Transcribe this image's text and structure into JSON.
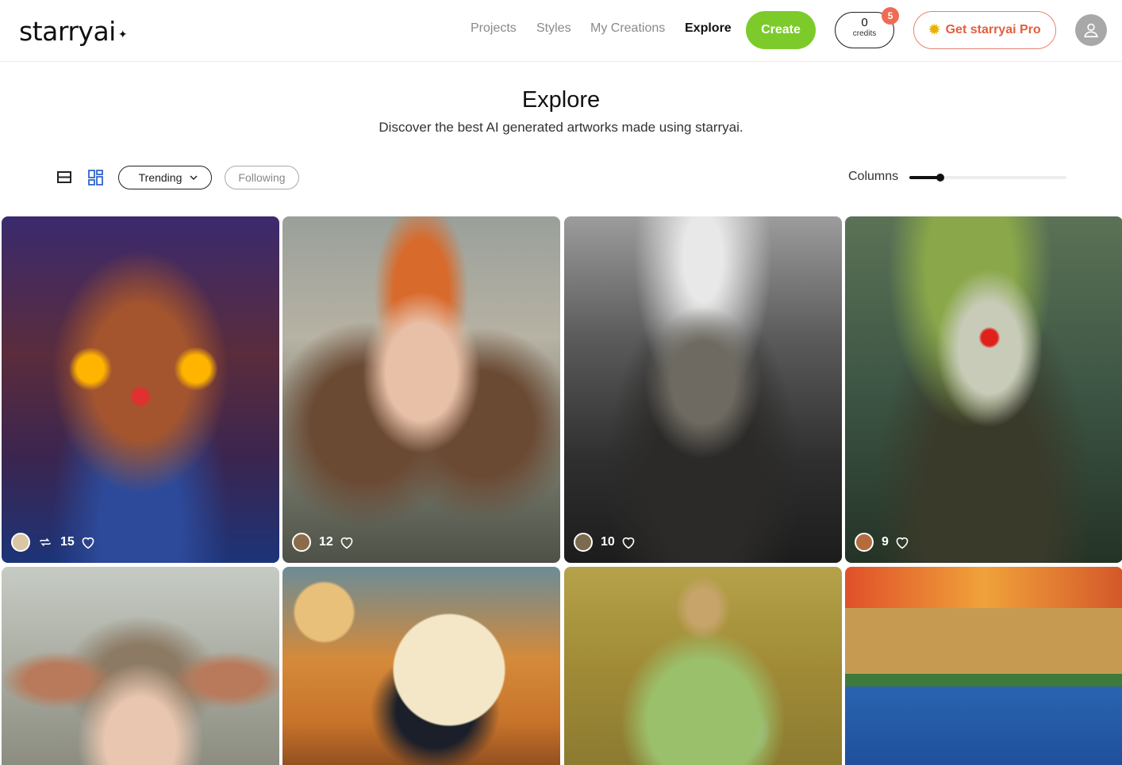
{
  "header": {
    "logo": "starryai",
    "logo_star": "✦",
    "nav": [
      {
        "label": "Projects",
        "active": false
      },
      {
        "label": "Styles",
        "active": false
      },
      {
        "label": "My Creations",
        "active": false
      },
      {
        "label": "Explore",
        "active": true
      }
    ],
    "create_label": "Create",
    "credits_count": "0",
    "credits_label": "credits",
    "notification_count": "5",
    "pro_label": "Get starryai Pro",
    "pro_icon": "sun-icon",
    "avatar_icon": "user-icon"
  },
  "page": {
    "title": "Explore",
    "subtitle": "Discover the best AI generated artworks made using starryai."
  },
  "toolbar": {
    "sort_label": "Trending",
    "following_label": "Following",
    "columns_label": "Columns",
    "columns_slider_fraction": 0.2
  },
  "colors": {
    "accent_green": "#7ccb2b",
    "pro_orange": "#e0603f",
    "badge_red": "#f06b55"
  },
  "gallery": [
    {
      "subject": "cosmic cat",
      "likes": "15",
      "has_remix": true
    },
    {
      "subject": "autumn girl",
      "likes": "12",
      "has_remix": false
    },
    {
      "subject": "horned beast",
      "likes": "10",
      "has_remix": false
    },
    {
      "subject": "mushroom clown",
      "likes": "9",
      "has_remix": false
    },
    {
      "subject": "horned child",
      "likes": "",
      "has_remix": false
    },
    {
      "subject": "black horse",
      "likes": "",
      "has_remix": false
    },
    {
      "subject": "fairy in bottle",
      "likes": "",
      "has_remix": false
    },
    {
      "subject": "lake house",
      "likes": "",
      "has_remix": false
    }
  ]
}
